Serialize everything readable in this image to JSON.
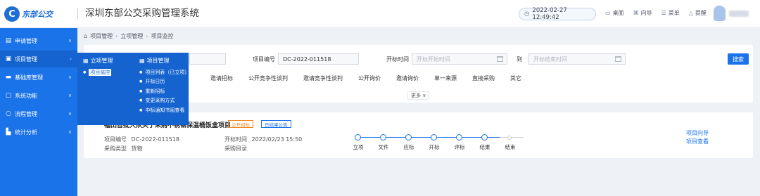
{
  "header": {
    "logo_mark": "C",
    "logo_text": "东部公交",
    "system_title": "深圳东部公交采购管理系统",
    "datetime": "2022-02-27 12:49:42",
    "nav": [
      {
        "icon": "desktop-icon",
        "label": "桌面"
      },
      {
        "icon": "guide-icon",
        "label": "向导"
      },
      {
        "icon": "menu-icon",
        "label": "菜单"
      },
      {
        "icon": "bell-icon",
        "label": "提醒"
      }
    ]
  },
  "sidebar": {
    "items": [
      {
        "icon": "apply-icon",
        "label": "申请管理",
        "expanded": false
      },
      {
        "icon": "project-icon",
        "label": "项目管理",
        "expanded": true
      },
      {
        "icon": "database-icon",
        "label": "基础库管理",
        "expanded": false
      },
      {
        "icon": "system-icon",
        "label": "系统功能",
        "expanded": false
      },
      {
        "icon": "flow-icon",
        "label": "流程管理",
        "expanded": false
      },
      {
        "icon": "stats-icon",
        "label": "统计分析",
        "expanded": false
      }
    ]
  },
  "flyout": {
    "col1": {
      "title": "立项管理",
      "items": [
        "项目监控"
      ]
    },
    "col2": {
      "title": "项目管理",
      "items": [
        "项目列表（已立项）",
        "开标日历",
        "重新招标",
        "变更采购方式",
        "中标通知书阅查看"
      ]
    }
  },
  "breadcrumb": [
    "项目管理",
    "立项管理",
    "项目监控"
  ],
  "search": {
    "project_no_label": "项目编号",
    "project_no_value": "DC-2022-011518",
    "open_time_label": "开标时间",
    "start_placeholder": "开标开始时间",
    "to_label": "到",
    "end_placeholder": "开标结束时间",
    "search_button": "搜索",
    "filters": [
      "邀请招标",
      "公开竞争性谈判",
      "邀请竞争性谈判",
      "公开询价",
      "邀请询价",
      "单一来源",
      "直接采购",
      "其它"
    ],
    "more_label": "更多 ∨"
  },
  "project": {
    "title": "福田首批大队关于采购不锈钢保温桶饭盒项目",
    "tags": [
      "公开招标",
      "已结果公告"
    ],
    "no_label": "项目编号",
    "no_value": "DC-2022-011518",
    "type_label": "采购类型",
    "type_value": "货物",
    "open_time_label": "开标时间",
    "open_time_value": "2022/02/23 15:50",
    "catalog_label": "采购目录",
    "timeline": [
      "立项",
      "文件",
      "应标",
      "开标",
      "评标",
      "结果",
      "结束"
    ],
    "timeline_completed": 6,
    "actions": [
      "项目向导",
      "项目查看"
    ]
  },
  "colors": {
    "primary": "#1a73e8",
    "sidebar": "#1a73e8",
    "flyout": "#1563cf",
    "tag_orange": "#f08a24"
  }
}
